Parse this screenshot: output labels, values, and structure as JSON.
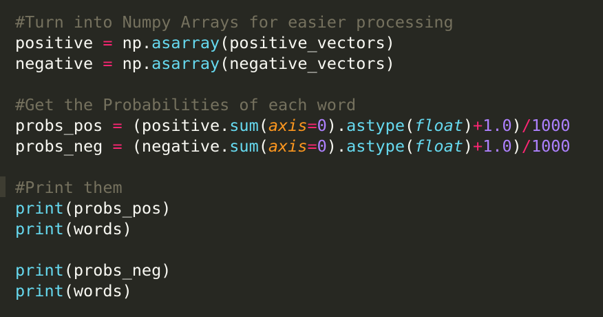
{
  "editor": {
    "colors": {
      "background": "#272822",
      "comment": "#75715e",
      "plain": "#f8f8f2",
      "operator": "#f92672",
      "function": "#66d9ef",
      "parameter": "#fd971f",
      "number": "#ae81ff"
    },
    "lines": [
      {
        "tokens": [
          {
            "cls": "comment",
            "text": "#Turn into Numpy Arrays for easier processing"
          }
        ]
      },
      {
        "tokens": [
          {
            "cls": "plain",
            "text": "positive "
          },
          {
            "cls": "op",
            "text": "="
          },
          {
            "cls": "plain",
            "text": " np."
          },
          {
            "cls": "func",
            "text": "asarray"
          },
          {
            "cls": "plain",
            "text": "(positive_vectors)"
          }
        ]
      },
      {
        "tokens": [
          {
            "cls": "plain",
            "text": "negative "
          },
          {
            "cls": "op",
            "text": "="
          },
          {
            "cls": "plain",
            "text": " np."
          },
          {
            "cls": "func",
            "text": "asarray"
          },
          {
            "cls": "plain",
            "text": "(negative_vectors)"
          }
        ]
      },
      {
        "tokens": []
      },
      {
        "tokens": [
          {
            "cls": "comment",
            "text": "#Get the Probabilities of each word"
          }
        ]
      },
      {
        "tokens": [
          {
            "cls": "plain",
            "text": "probs_pos "
          },
          {
            "cls": "op",
            "text": "="
          },
          {
            "cls": "plain",
            "text": " (positive."
          },
          {
            "cls": "func",
            "text": "sum"
          },
          {
            "cls": "plain",
            "text": "("
          },
          {
            "cls": "param",
            "text": "axis"
          },
          {
            "cls": "op",
            "text": "="
          },
          {
            "cls": "num",
            "text": "0"
          },
          {
            "cls": "plain",
            "text": ")."
          },
          {
            "cls": "func",
            "text": "astype"
          },
          {
            "cls": "plain",
            "text": "("
          },
          {
            "cls": "type",
            "text": "float"
          },
          {
            "cls": "plain",
            "text": ")"
          },
          {
            "cls": "op",
            "text": "+"
          },
          {
            "cls": "num",
            "text": "1.0"
          },
          {
            "cls": "plain",
            "text": ")"
          },
          {
            "cls": "op",
            "text": "/"
          },
          {
            "cls": "num",
            "text": "1000"
          }
        ]
      },
      {
        "tokens": [
          {
            "cls": "plain",
            "text": "probs_neg "
          },
          {
            "cls": "op",
            "text": "="
          },
          {
            "cls": "plain",
            "text": " (negative."
          },
          {
            "cls": "func",
            "text": "sum"
          },
          {
            "cls": "plain",
            "text": "("
          },
          {
            "cls": "param",
            "text": "axis"
          },
          {
            "cls": "op",
            "text": "="
          },
          {
            "cls": "num",
            "text": "0"
          },
          {
            "cls": "plain",
            "text": ")."
          },
          {
            "cls": "func",
            "text": "astype"
          },
          {
            "cls": "plain",
            "text": "("
          },
          {
            "cls": "type",
            "text": "float"
          },
          {
            "cls": "plain",
            "text": ")"
          },
          {
            "cls": "op",
            "text": "+"
          },
          {
            "cls": "num",
            "text": "1.0"
          },
          {
            "cls": "plain",
            "text": ")"
          },
          {
            "cls": "op",
            "text": "/"
          },
          {
            "cls": "num",
            "text": "1000"
          }
        ]
      },
      {
        "tokens": []
      },
      {
        "tokens": [
          {
            "cls": "comment",
            "text": "#Print them"
          }
        ]
      },
      {
        "tokens": [
          {
            "cls": "func",
            "text": "print"
          },
          {
            "cls": "plain",
            "text": "(probs_pos)"
          }
        ]
      },
      {
        "tokens": [
          {
            "cls": "func",
            "text": "print"
          },
          {
            "cls": "plain",
            "text": "(words)"
          }
        ]
      },
      {
        "tokens": []
      },
      {
        "tokens": [
          {
            "cls": "func",
            "text": "print"
          },
          {
            "cls": "plain",
            "text": "(probs_neg)"
          }
        ]
      },
      {
        "tokens": [
          {
            "cls": "func",
            "text": "print"
          },
          {
            "cls": "plain",
            "text": "(words)"
          }
        ]
      }
    ]
  }
}
